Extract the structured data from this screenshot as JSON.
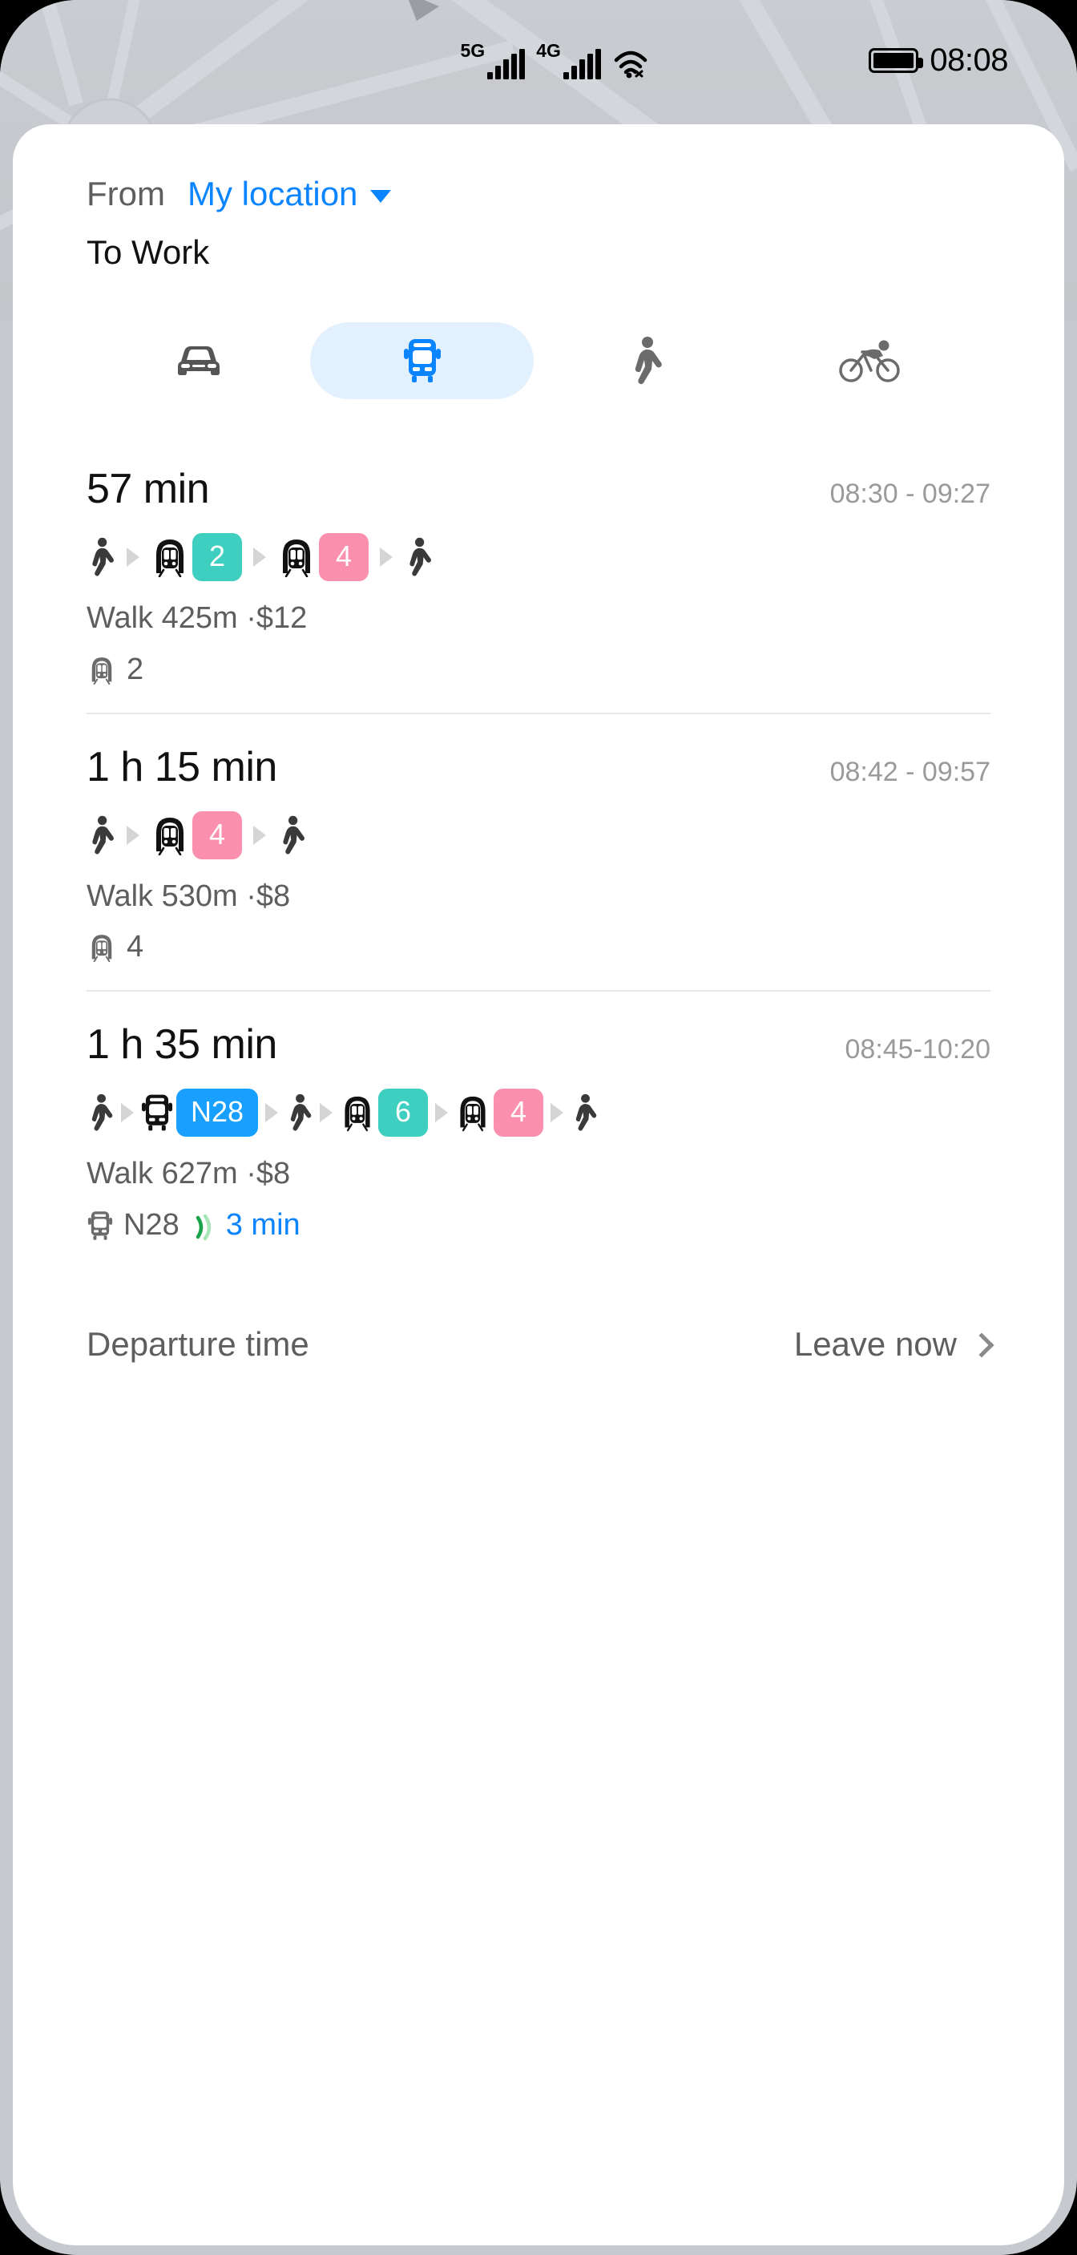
{
  "status_bar": {
    "network_5g_label": "5G",
    "network_4g_label": "4G",
    "wifi_icon": "wifi-icon",
    "battery_icon": "battery-full-icon",
    "time": "08:08"
  },
  "search": {
    "from_label": "From",
    "from_value": "My location",
    "from_caret_icon": "chevron-down-icon",
    "to_value": "To Work"
  },
  "modes": [
    {
      "id": "car",
      "icon": "car-icon",
      "selected": false
    },
    {
      "id": "transit",
      "icon": "bus-icon",
      "selected": true
    },
    {
      "id": "walk",
      "icon": "walking-icon",
      "selected": false
    },
    {
      "id": "bike",
      "icon": "cycling-icon",
      "selected": false
    }
  ],
  "colors": {
    "accent_blue": "#0a84ff",
    "selected_tab_bg": "#e3f1fe",
    "line_teal": "#3ecfc0",
    "line_pink": "#fb8fae",
    "bus_blue": "#19a0ff",
    "live_green": "#2eb82e",
    "muted_text": "#5e5e5e",
    "time_text": "#9a9a9a"
  },
  "routes": [
    {
      "duration": "57 min",
      "window": "08:30 - 09:27",
      "legs": [
        {
          "type": "walk",
          "icon": "walking-icon"
        },
        {
          "type": "metro",
          "icon": "metro-icon",
          "line": "2",
          "color": "#3ecfc0"
        },
        {
          "type": "metro",
          "icon": "metro-icon",
          "line": "4",
          "color": "#fb8fae"
        },
        {
          "type": "walk",
          "icon": "walking-icon"
        }
      ],
      "meta": "Walk 425m ·$12",
      "sub": {
        "icon": "metro-icon",
        "text": "2",
        "live": false
      }
    },
    {
      "duration": "1 h 15 min",
      "window": "08:42 - 09:57",
      "legs": [
        {
          "type": "walk",
          "icon": "walking-icon"
        },
        {
          "type": "metro",
          "icon": "metro-icon",
          "line": "4",
          "color": "#fb8fae"
        },
        {
          "type": "walk",
          "icon": "walking-icon"
        }
      ],
      "meta": "Walk 530m ·$8",
      "sub": {
        "icon": "metro-icon",
        "text": "4",
        "live": false
      }
    },
    {
      "duration": "1 h 35 min",
      "window": "08:45-10:20",
      "legs": [
        {
          "type": "walk",
          "icon": "walking-icon"
        },
        {
          "type": "bus",
          "icon": "bus-icon",
          "line": "N28",
          "color": "#19a0ff"
        },
        {
          "type": "walk",
          "icon": "walking-icon"
        },
        {
          "type": "metro",
          "icon": "metro-icon",
          "line": "6",
          "color": "#3ecfc0"
        },
        {
          "type": "metro",
          "icon": "metro-icon",
          "line": "4",
          "color": "#fb8fae"
        },
        {
          "type": "walk",
          "icon": "walking-icon"
        }
      ],
      "meta": "Walk 627m ·$8",
      "sub": {
        "icon": "bus-icon",
        "text": "N28",
        "live": true,
        "live_icon": "live-signal-icon",
        "eta": "3 min"
      }
    }
  ],
  "departure": {
    "label": "Departure time",
    "action": "Leave now",
    "chevron_icon": "chevron-right-icon"
  }
}
